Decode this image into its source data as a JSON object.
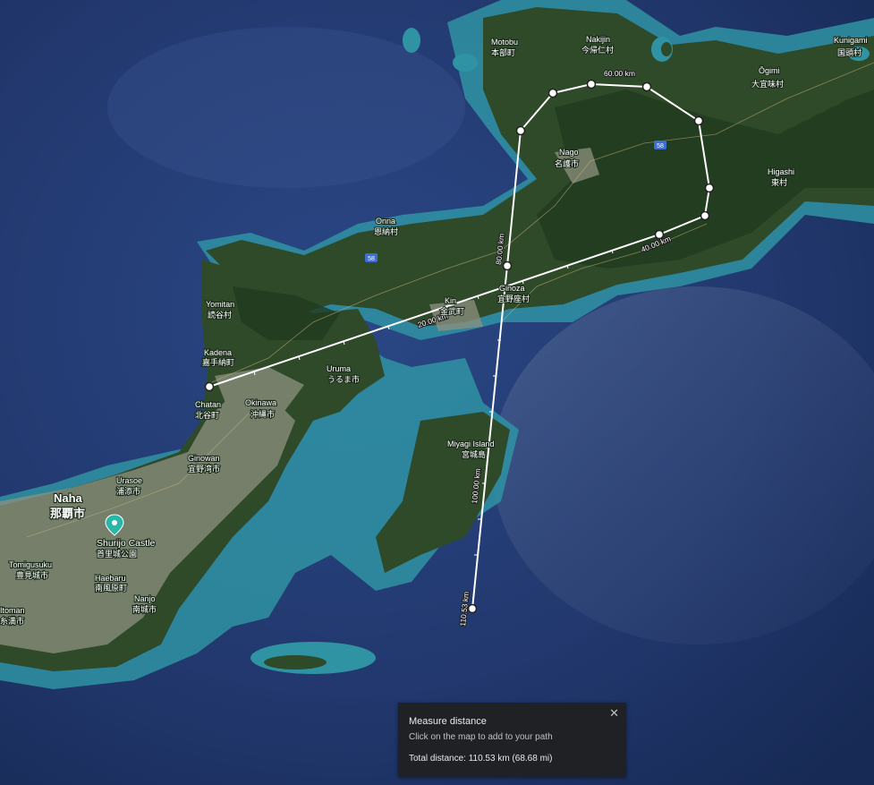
{
  "map": {
    "places": {
      "motobu_en": "Motobu",
      "motobu_ja": "本部町",
      "nakijin_en": "Nakijin",
      "nakijin_ja": "今帰仁村",
      "ogimi_en": "Ōgimi",
      "ogimi_ja": "大宜味村",
      "kunigami_en": "Kunigami",
      "kunigami_ja": "国頭村",
      "nago_en": "Nago",
      "nago_ja": "名護市",
      "higashi_en": "Higashi",
      "higashi_ja": "東村",
      "onna_en": "Onna",
      "onna_ja": "恩納村",
      "kin_en": "Kin",
      "kin_ja": "金武町",
      "ginoza_en": "Ginoza",
      "ginoza_ja": "宜野座村",
      "yomitan_en": "Yomitan",
      "yomitan_ja": "読谷村",
      "kadena_en": "Kadena",
      "kadena_ja": "嘉手納町",
      "uruma_en": "Uruma",
      "uruma_ja": "うるま市",
      "chatan_en": "Chatan",
      "chatan_ja": "北谷町",
      "okinawa_en": "Okinawa",
      "okinawa_ja": "沖縄市",
      "ginowan_en": "Ginowan",
      "ginowan_ja": "宜野湾市",
      "urasoe_en": "Urasoe",
      "urasoe_ja": "浦添市",
      "naha_en": "Naha",
      "naha_ja": "那覇市",
      "shurijo_en": "Shurijo Castle",
      "shurijo_ja": "首里城公園",
      "tomigusuku_en": "Tomigusuku",
      "tomigusuku_ja": "豊見城市",
      "haebaru_en": "Haebaru",
      "haebaru_ja": "南風原町",
      "nanjo_en": "Nanjo",
      "nanjo_ja": "南城市",
      "itoman_en": "Itoman",
      "itoman_ja": "糸満市",
      "miyagi_en": "Miyagi Island",
      "miyagi_ja": "宮城島"
    },
    "road_shield": "58",
    "distance_labels": {
      "d20": "20.00 km",
      "d40": "40.00 km",
      "d60": "60.00 km",
      "d80": "80.00 km",
      "d100": "100.00 km",
      "d110": "110.53 km"
    },
    "colors": {
      "ocean": "#1c2f5e",
      "land": "#2f4a2a",
      "reef": "#2a8f9c",
      "urban": "#8a8f7e",
      "path": "#ffffff"
    }
  },
  "panel": {
    "title": "Measure distance",
    "hint": "Click on the map to add to your path",
    "total": "Total distance: 110.53 km (68.68 mi)",
    "close_icon": "close-icon"
  }
}
